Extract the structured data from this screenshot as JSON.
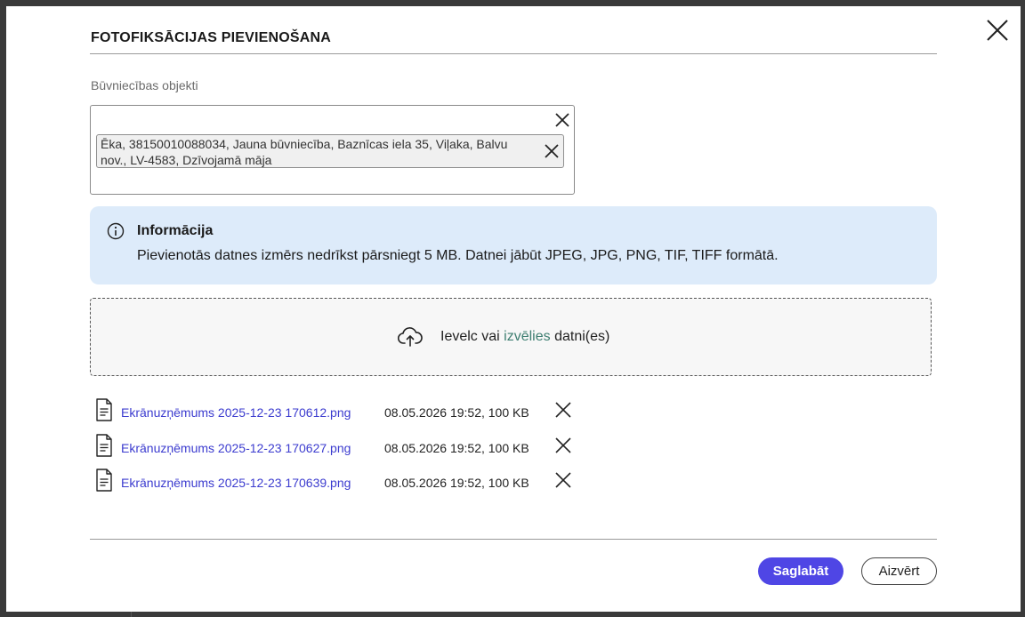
{
  "dialog": {
    "title": "FOTOFIKSĀCIJAS PIEVIENOŠANA",
    "close_icon": "close-icon"
  },
  "objects_field": {
    "label": "Būvniecības objekti",
    "selected": [
      {
        "text": "Ēka, 38150010088034, Jauna būvniecība, Baznīcas iela 35, Viļaka, Balvu nov., LV-4583, Dzīvojamā māja"
      }
    ]
  },
  "info": {
    "icon": "info-icon",
    "title": "Informācija",
    "text": "Pievienotās datnes izmērs nedrīkst pārsniegt 5 MB. Datnei jābūt JPEG, JPG, PNG, TIF, TIFF formātā.",
    "bg_color": "#ddebfa"
  },
  "dropzone": {
    "icon": "cloud-upload-icon",
    "prefix": "Ievelc vai",
    "link": "izvēlies",
    "suffix": "datni(es)",
    "link_color": "#3f7f72"
  },
  "files": [
    {
      "name": "Ekrānuzņēmums 2025-12-23 170612.png",
      "meta": "08.05.2026 19:52, 100 KB"
    },
    {
      "name": "Ekrānuzņēmums 2025-12-23 170627.png",
      "meta": "08.05.2026 19:52, 100 KB"
    },
    {
      "name": "Ekrānuzņēmums 2025-12-23 170639.png",
      "meta": "08.05.2026 19:52, 100 KB"
    }
  ],
  "footer": {
    "save_label": "Saglabāt",
    "close_label": "Aizvērt",
    "accent_color": "#4f46e5"
  }
}
